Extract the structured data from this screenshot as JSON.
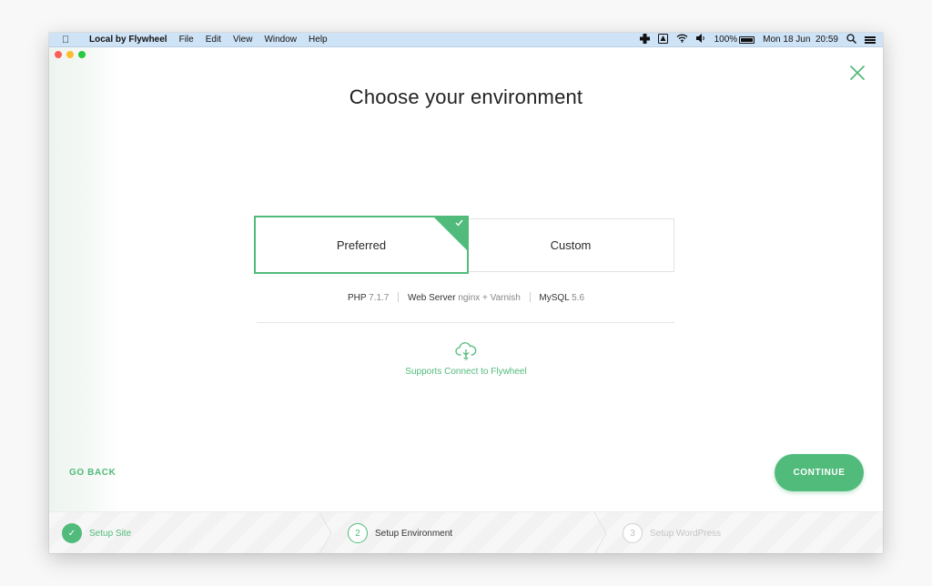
{
  "menubar": {
    "app_name": "Local by Flywheel",
    "menus": [
      "File",
      "Edit",
      "View",
      "Window",
      "Help"
    ],
    "battery_percent": "100%",
    "datetime": "Mon 18 Jun  20:59"
  },
  "dialog": {
    "title": "Choose your environment",
    "options": [
      {
        "label": "Preferred",
        "selected": true
      },
      {
        "label": "Custom",
        "selected": false
      }
    ],
    "specs": {
      "php_label": "PHP",
      "php_value": "7.1.7",
      "server_label": "Web Server",
      "server_value": "nginx + Varnish",
      "mysql_label": "MySQL",
      "mysql_value": "5.6"
    },
    "connect_text": "Supports Connect to Flywheel",
    "go_back": "GO BACK",
    "continue": "CONTINUE"
  },
  "steps": [
    {
      "number": "✓",
      "label": "Setup Site",
      "state": "done"
    },
    {
      "number": "2",
      "label": "Setup Environment",
      "state": "current"
    },
    {
      "number": "3",
      "label": "Setup WordPress",
      "state": "future"
    }
  ],
  "colors": {
    "accent": "#51bb7b",
    "menubar": "#cfe3f7"
  }
}
